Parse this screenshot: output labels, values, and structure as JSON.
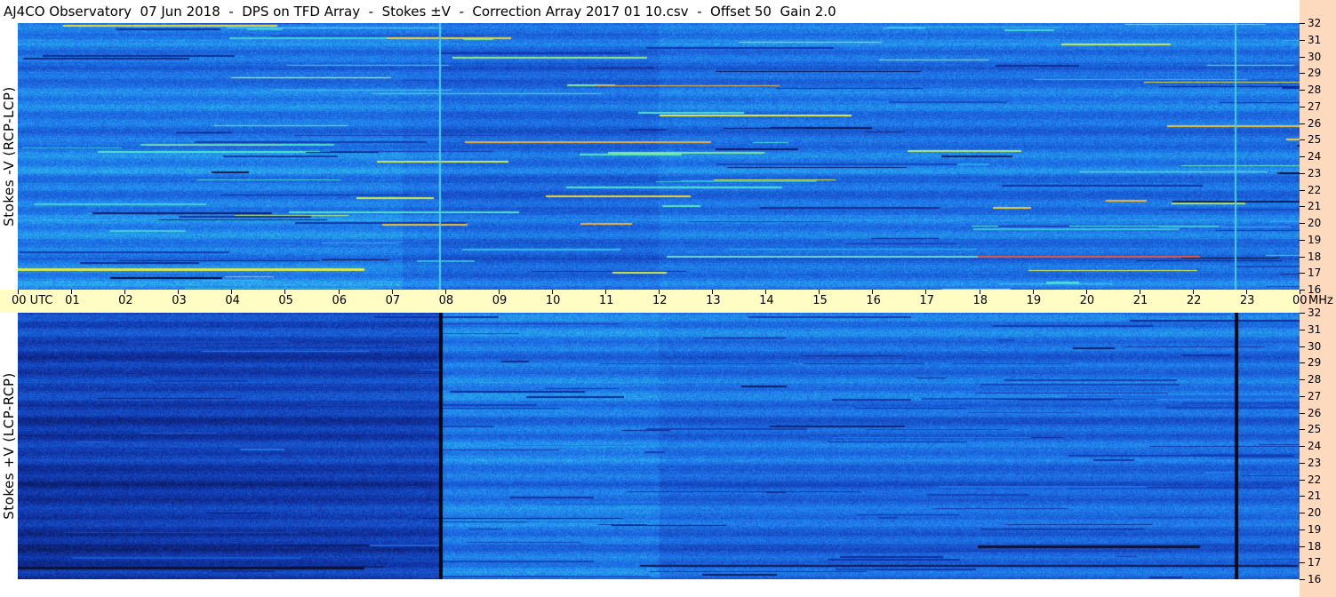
{
  "title": "AJ4CO Observatory  07 Jun 2018  -  DPS on TFD Array  -  Stokes ±V  -  Correction Array 2017 01 10.csv  -  Offset 50  Gain 2.0",
  "top_panel": {
    "ylabel": "Stokes -V (RCP-LCP)"
  },
  "bottom_panel": {
    "ylabel": "Stokes +V (LCP-RCP)"
  },
  "time_axis": {
    "labels": [
      "00 UTC",
      "01",
      "02",
      "03",
      "04",
      "05",
      "06",
      "07",
      "08",
      "09",
      "10",
      "11",
      "12",
      "13",
      "14",
      "15",
      "16",
      "17",
      "18",
      "19",
      "20",
      "21",
      "22",
      "23",
      "00"
    ]
  },
  "freq_axis": {
    "unit": "MHz",
    "labels": [
      "32",
      "31",
      "30",
      "29",
      "28",
      "27",
      "26",
      "25",
      "24",
      "23",
      "22",
      "21",
      "20",
      "19",
      "18",
      "17",
      "16"
    ]
  },
  "colors": {
    "background_strip": "#fdd9bd",
    "time_axis_bg": "#fffdc4",
    "spectrogram_base": "#1e6ee6",
    "spectrogram_high": "#f0f020",
    "spectrogram_low": "#0a1a60"
  },
  "chart_data": [
    {
      "type": "heatmap",
      "panel": "top",
      "ylabel": "Stokes -V (RCP-LCP)",
      "x_range_utc_hours": [
        0,
        24
      ],
      "y_range_mhz": [
        16,
        32
      ],
      "notable_features": [
        {
          "label": "broadband line",
          "time_utc": 7.9
        },
        {
          "label": "broadband line",
          "time_utc": 22.8
        }
      ]
    },
    {
      "type": "heatmap",
      "panel": "bottom",
      "ylabel": "Stokes +V (LCP-RCP)",
      "x_range_utc_hours": [
        0,
        24
      ],
      "y_range_mhz": [
        16,
        32
      ],
      "notable_features": [
        {
          "label": "broadband line",
          "time_utc": 7.9
        },
        {
          "label": "broadband line",
          "time_utc": 22.8
        }
      ]
    }
  ]
}
